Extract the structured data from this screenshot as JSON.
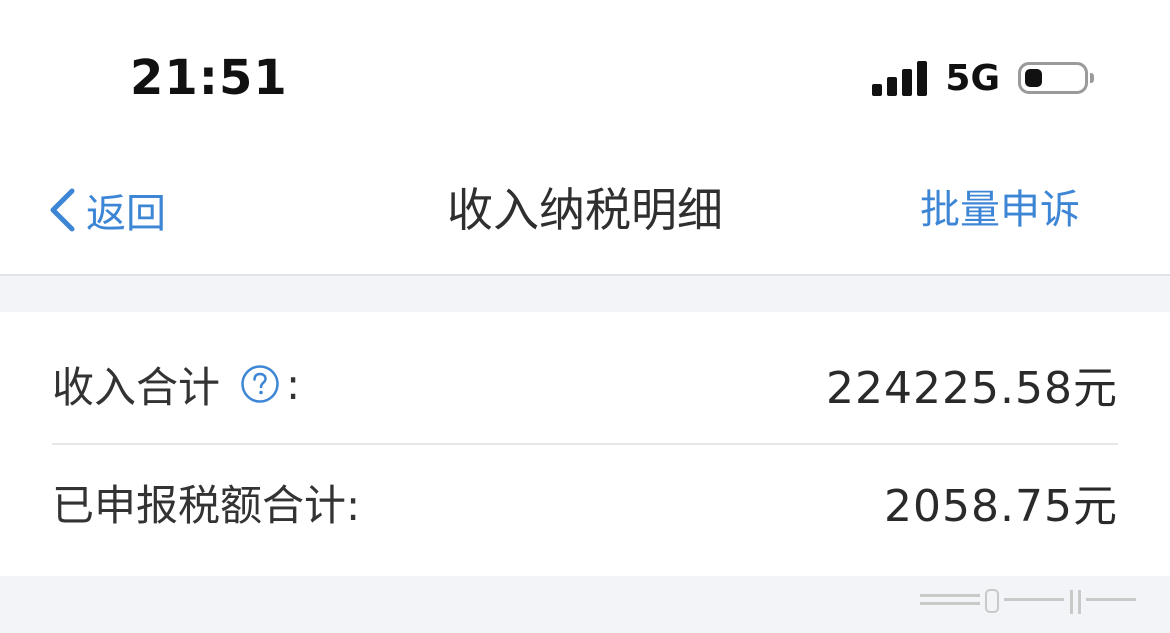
{
  "status_bar": {
    "time": "21:51",
    "network": "5G",
    "signal_bars": 4,
    "battery_level": 0.3
  },
  "nav": {
    "back_label": "返回",
    "title": "收入纳税明细",
    "action_label": "批量申诉"
  },
  "summary": {
    "income_label": "收入合计",
    "income_colon": ":",
    "income_value": "224225.58元",
    "tax_label": "已申报税额合计:",
    "tax_value": "2058.75元"
  },
  "colors": {
    "accent": "#3d86d6",
    "text": "#333333",
    "background_gray": "#f3f4f7"
  },
  "icons": {
    "back": "chevron-left-icon",
    "help": "question-circle-icon",
    "signal": "cellular-signal-icon",
    "battery": "battery-icon"
  }
}
